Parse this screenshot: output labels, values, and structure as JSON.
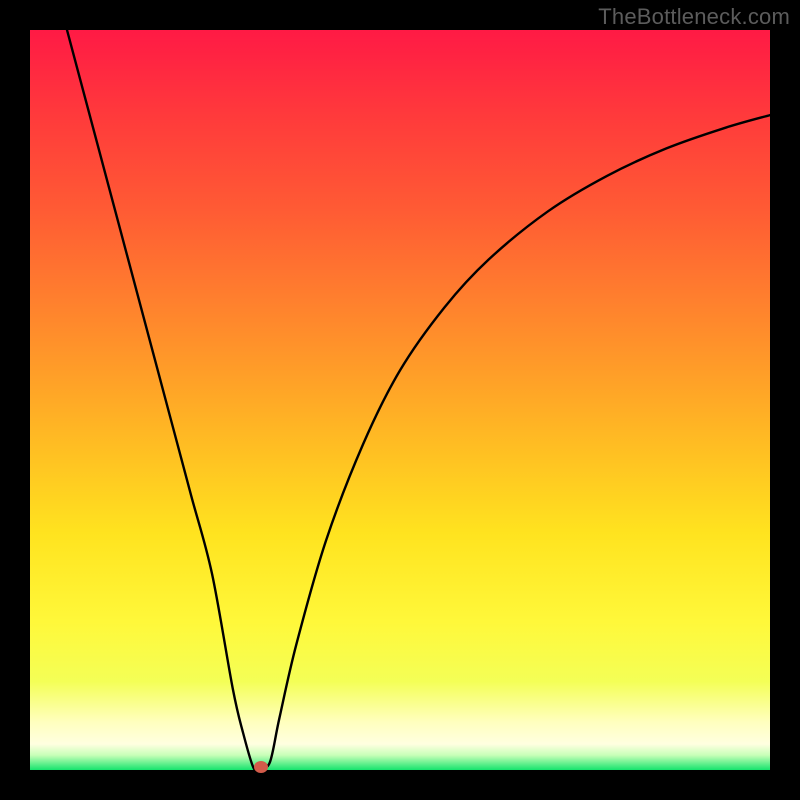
{
  "watermark": "TheBottleneck.com",
  "chart_data": {
    "type": "line",
    "title": "",
    "xlabel": "",
    "ylabel": "",
    "xlim": [
      0,
      1
    ],
    "ylim": [
      0,
      1
    ],
    "series": [
      {
        "name": "curve",
        "x": [
          0.05,
          0.078,
          0.106,
          0.134,
          0.162,
          0.19,
          0.218,
          0.246,
          0.274,
          0.288,
          0.302,
          0.31,
          0.324,
          0.337,
          0.36,
          0.4,
          0.45,
          0.5,
          0.56,
          0.62,
          0.7,
          0.78,
          0.86,
          0.94,
          1.0
        ],
        "y": [
          1.0,
          0.895,
          0.79,
          0.685,
          0.58,
          0.475,
          0.37,
          0.265,
          0.11,
          0.05,
          0.003,
          0.003,
          0.01,
          0.07,
          0.17,
          0.31,
          0.44,
          0.54,
          0.625,
          0.69,
          0.755,
          0.803,
          0.84,
          0.868,
          0.885
        ]
      }
    ],
    "marker": {
      "x": 0.312,
      "y": 0.0
    },
    "gradient_stops": [
      {
        "pos": 0.0,
        "color": "#ff1a45"
      },
      {
        "pos": 0.5,
        "color": "#ffb524"
      },
      {
        "pos": 0.8,
        "color": "#fff83a"
      },
      {
        "pos": 0.965,
        "color": "#ffffe0"
      },
      {
        "pos": 1.0,
        "color": "#16e46e"
      }
    ]
  }
}
